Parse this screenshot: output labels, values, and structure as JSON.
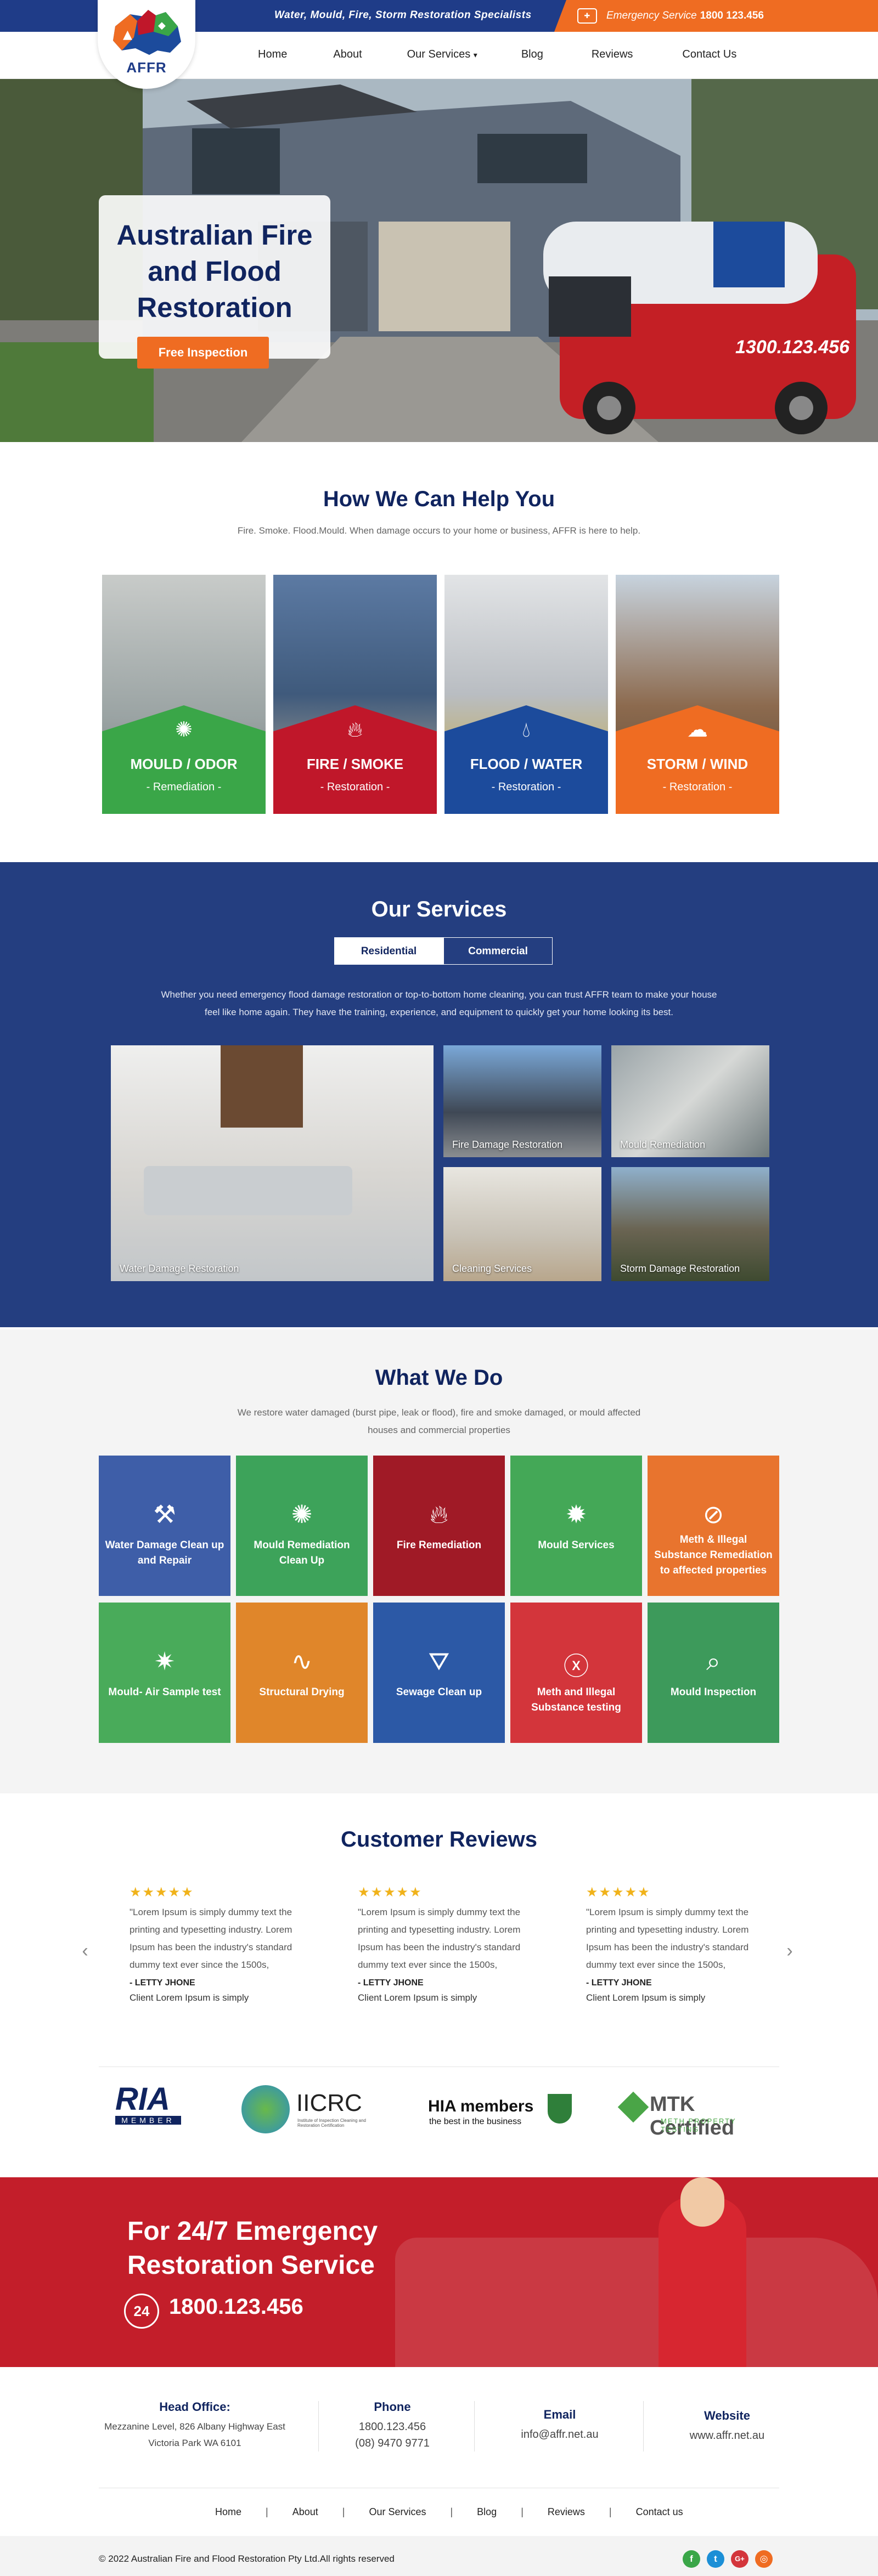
{
  "topbar": {
    "tagline": "Water, Mould, Fire, Storm Restoration Specialists",
    "emergency_label": "Emergency Service",
    "emergency_phone": "1800 123.456",
    "icon": "ambulance-icon"
  },
  "logo": {
    "text": "AFFR"
  },
  "nav": {
    "items": [
      "Home",
      "About",
      "Our Services",
      "Blog",
      "Reviews",
      "Contact Us"
    ],
    "dropdown_indicator": "▾"
  },
  "hero": {
    "title": "Australian Fire and Flood Restoration",
    "cta": "Free Inspection",
    "van_phone": "1300.123.456"
  },
  "help": {
    "title": "How We Can Help You",
    "subtitle": "Fire. Smoke. Flood.Mould. When damage occurs to your home or business, AFFR is here to help.",
    "cards": [
      {
        "title": "MOULD / ODOR",
        "sub": "- Remediation -",
        "color": "#3aa648",
        "icon": "virus-icon"
      },
      {
        "title": "FIRE / SMOKE",
        "sub": "- Restoration -",
        "color": "#c0172a",
        "icon": "flame-icon"
      },
      {
        "title": "FLOOD / WATER",
        "sub": "- Restoration -",
        "color": "#1c4b9c",
        "icon": "water-drop-icon"
      },
      {
        "title": "STORM / WIND",
        "sub": "- Restoration -",
        "color": "#ef6c22",
        "icon": "storm-cloud-icon"
      }
    ]
  },
  "services": {
    "title": "Our Services",
    "tabs": [
      "Residential",
      "Commercial"
    ],
    "description": "Whether you need emergency flood damage restoration or top-to-bottom home cleaning, you can trust AFFR team to make your house feel like home again. They have the training, experience, and equipment to quickly get your home looking its best.",
    "items": [
      "Water Damage Restoration",
      "Fire Damage Restoration",
      "Mould Remediation",
      "Cleaning Services",
      "Storm Damage Restoration"
    ]
  },
  "what_we_do": {
    "title": "What We Do",
    "subtitle": "We restore water damaged (burst pipe, leak or flood), fire and smoke damaged, or mould affected houses and commercial properties",
    "tiles": [
      {
        "label": "Water Damage Clean up and Repair",
        "color": "#3e5ea8",
        "icon": "pipe-icon"
      },
      {
        "label": "Mould Remediation Clean Up",
        "color": "#3da35a",
        "icon": "mould-icon"
      },
      {
        "label": "Fire Remediation",
        "color": "#a01a26",
        "icon": "flame-icon"
      },
      {
        "label": "Mould Services",
        "color": "#44a857",
        "icon": "virus-icon"
      },
      {
        "label": "Meth & Illegal Substance Remediation to affected properties",
        "color": "#e8742e",
        "icon": "prohibited-icon"
      },
      {
        "label": "Mould- Air Sample test",
        "color": "#49ab5a",
        "icon": "air-sample-icon"
      },
      {
        "label": "Structural Drying",
        "color": "#e0862a",
        "icon": "drying-icon"
      },
      {
        "label": "Sewage Clean up",
        "color": "#2c59a6",
        "icon": "sewage-icon"
      },
      {
        "label": "Meth and Illegal Substance testing",
        "color": "#d3353b",
        "icon": "x-circle-icon"
      },
      {
        "label": "Mould Inspection",
        "color": "#3d9a5b",
        "icon": "magnifier-icon"
      }
    ]
  },
  "reviews": {
    "title": "Customer Reviews",
    "items": [
      {
        "stars": "★★★★★",
        "text": "\"Lorem Ipsum is simply dummy text the printing and typesetting industry. Lorem Ipsum has been the industry's standard dummy text ever since the 1500s,",
        "name": "- LETTY JHONE",
        "role": "Client Lorem Ipsum is simply"
      },
      {
        "stars": "★★★★★",
        "text": "\"Lorem Ipsum is simply dummy text the printing and typesetting industry. Lorem Ipsum has been the industry's standard dummy text ever since the 1500s,",
        "name": "- LETTY JHONE",
        "role": "Client Lorem Ipsum is simply"
      },
      {
        "stars": "★★★★★",
        "text": "\"Lorem Ipsum is simply dummy text the printing and typesetting industry. Lorem Ipsum has been the industry's standard dummy text ever since the 1500s,",
        "name": "- LETTY JHONE",
        "role": "Client Lorem Ipsum is simply"
      }
    ],
    "prev": "‹",
    "next": "›"
  },
  "partners": {
    "ria": "RIA",
    "ria_sub": "MEMBER",
    "iicrc": "IICRC",
    "iicrc_sub": "Institute of Inspection Cleaning and Restoration Certification",
    "hia": "HIA members",
    "hia_sub": "the best in the business",
    "mtk": "MTK Certified",
    "mtk_sub": "METH PROPERTY TESTING"
  },
  "emergency": {
    "title": "For 24/7 Emergency Restoration Service",
    "badge": "24",
    "phone": "1800.123.456"
  },
  "footer": {
    "office_label": "Head Office:",
    "office_value": "Mezzanine Level, 826 Albany Highway East Victoria Park WA 6101",
    "phone_label": "Phone",
    "phone_1": "1800.123.456",
    "phone_2": "(08) 9470 9771",
    "email_label": "Email",
    "email_value": "info@affr.net.au",
    "website_label": "Website",
    "website_value": "www.affr.net.au",
    "links": [
      "Home",
      "About",
      "Our Services",
      "Blog",
      "Reviews",
      "Contact us"
    ],
    "copyright": "© 2022 Australian Fire and Flood Restoration Pty Ltd.All rights reserved",
    "social": [
      "f",
      "t",
      "G+",
      "◎"
    ]
  }
}
